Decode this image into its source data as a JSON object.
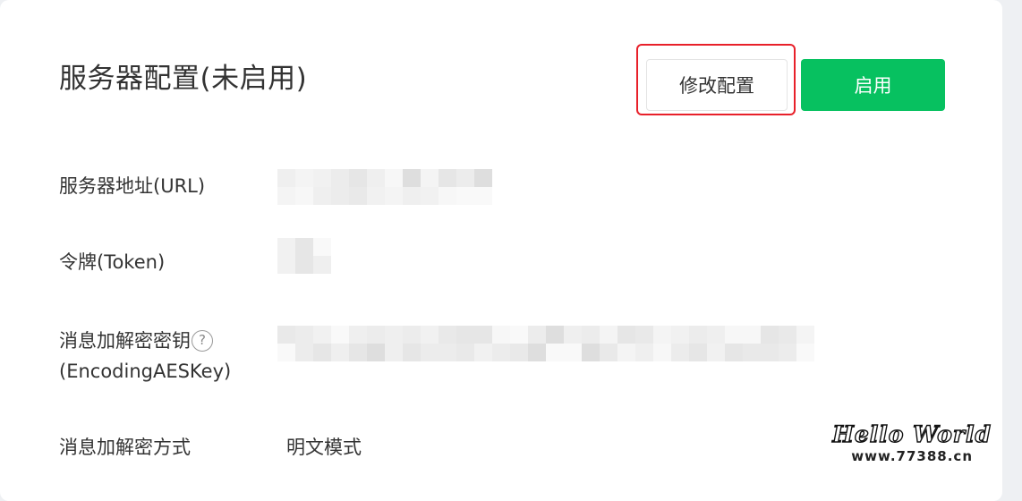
{
  "section": {
    "title": "服务器配置(未启用)"
  },
  "buttons": {
    "modify_label": "修改配置",
    "enable_label": "启用"
  },
  "fields": {
    "url_label": "服务器地址(URL)",
    "token_label": "令牌(Token)",
    "aeskey_label_line1": "消息加解密密钥",
    "aeskey_label_line2": "(EncodingAESKey)",
    "encrypt_mode_label": "消息加解密方式",
    "encrypt_mode_value": "明文模式"
  },
  "icons": {
    "help": "?"
  },
  "colors": {
    "primary_green": "#07c160",
    "highlight_red": "#e8202a"
  },
  "watermark": {
    "title": "Hello World",
    "url": "www.77388.cn"
  }
}
